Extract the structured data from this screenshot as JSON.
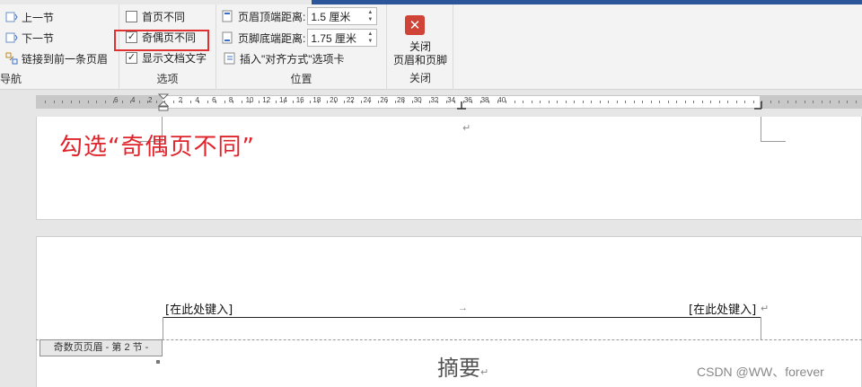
{
  "nav": {
    "prev_section": "上一节",
    "next_section": "下一节",
    "link_previous": "链接到前一条页眉",
    "group_label": "导航"
  },
  "options": {
    "different_first_page": "首页不同",
    "different_odd_even": "奇偶页不同",
    "show_document_text": "显示文档文字",
    "different_first_page_checked": false,
    "different_odd_even_checked": true,
    "show_document_text_checked": true,
    "check_glyph": "✓",
    "group_label": "选项"
  },
  "position": {
    "header_top_label": "页眉顶端距离:",
    "header_top_value": "1.5 厘米",
    "footer_bottom_label": "页脚底端距离:",
    "footer_bottom_value": "1.75 厘米",
    "insert_align_tab": "插入\"对齐方式\"选项卡",
    "group_label": "位置"
  },
  "close": {
    "icon": "close-icon",
    "label_line1": "关闭",
    "label_line2": "页眉和页脚",
    "group_label": "关闭"
  },
  "ruler": {
    "left_numbers": [
      "6",
      "4",
      "2"
    ],
    "numbers": [
      "2",
      "4",
      "6",
      "8",
      "10",
      "12",
      "14",
      "16",
      "18",
      "20",
      "22",
      "24",
      "26",
      "28",
      "30",
      "32",
      "34",
      "36",
      "38",
      "40"
    ]
  },
  "annotation": "勾选“奇偶页不同”",
  "document": {
    "header_left": "[在此处键入]",
    "header_right": "[在此处键入]",
    "header_tag": "奇数页页眉 - 第 2 节 -",
    "abstract": "摘要",
    "para_mark": "↵",
    "tab_mark": "→"
  },
  "watermark": "CSDN @WW、forever",
  "colors": {
    "title_bar": "#2b579a",
    "annotation": "#e0242c",
    "close_button": "#d04437"
  }
}
